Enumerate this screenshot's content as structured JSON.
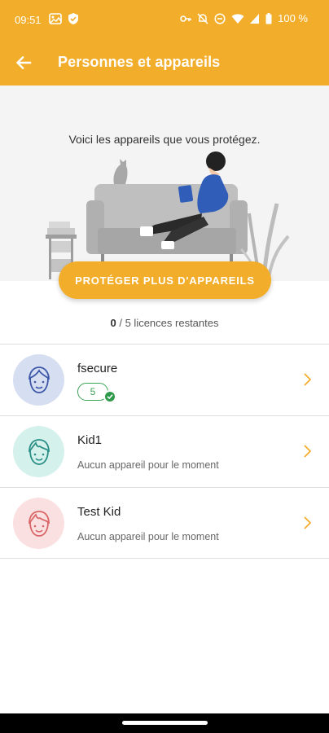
{
  "status": {
    "time": "09:51",
    "battery": "100 %",
    "icons_left": [
      "photos-icon",
      "shield-check-icon"
    ],
    "icons_right": [
      "key-icon",
      "mute-icon",
      "dnd-icon",
      "wifi-icon",
      "signal-icon",
      "battery-icon"
    ]
  },
  "appbar": {
    "title": "Personnes et appareils"
  },
  "hero": {
    "caption": "Voici les appareils que vous protégez."
  },
  "cta": {
    "label": "PROTÉGER PLUS D'APPAREILS"
  },
  "licenses": {
    "used": "0",
    "rest": " / 5 licences restantes"
  },
  "people": [
    {
      "name": "fsecure",
      "device_count": "5",
      "avatar_bg": "#d6dff1",
      "avatar_color": "#3d57a8"
    },
    {
      "name": "Kid1",
      "subtitle": "Aucun appareil pour le moment",
      "avatar_bg": "#d5f1ec",
      "avatar_color": "#2a8f86"
    },
    {
      "name": "Test Kid",
      "subtitle": "Aucun appareil pour le moment",
      "avatar_bg": "#fbe0e1",
      "avatar_color": "#d96767"
    }
  ],
  "colors": {
    "accent": "#f2ae2a",
    "success": "#3aa355"
  }
}
